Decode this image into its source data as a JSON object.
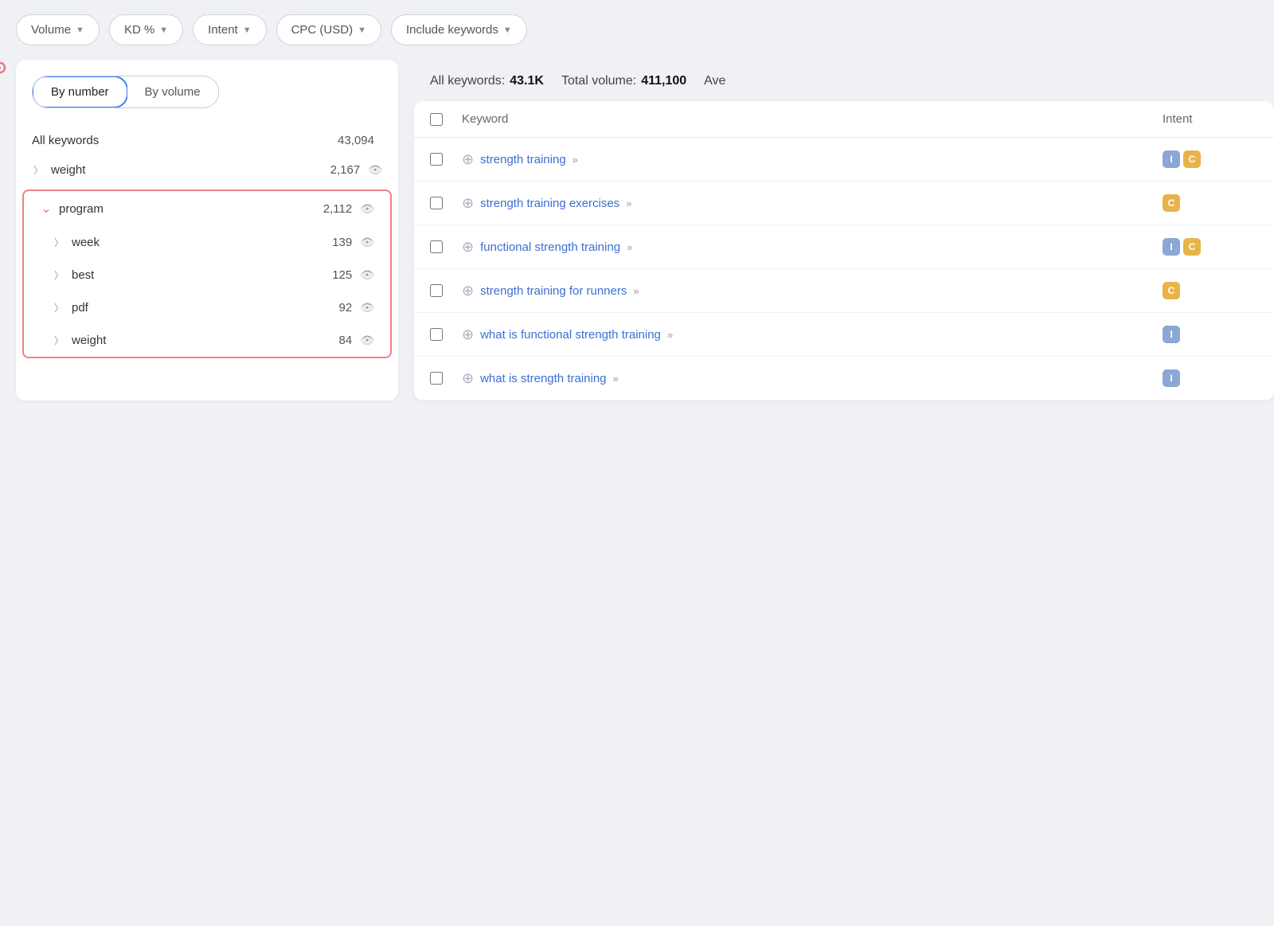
{
  "filterBar": {
    "buttons": [
      {
        "label": "Volume",
        "id": "volume"
      },
      {
        "label": "KD %",
        "id": "kd"
      },
      {
        "label": "Intent",
        "id": "intent"
      },
      {
        "label": "CPC (USD)",
        "id": "cpc"
      },
      {
        "label": "Include keywords",
        "id": "include"
      }
    ]
  },
  "sidebar": {
    "toggles": [
      {
        "label": "By number",
        "active": true
      },
      {
        "label": "By volume",
        "active": false
      }
    ],
    "allKeywords": {
      "label": "All keywords",
      "count": "43,094"
    },
    "rows": [
      {
        "id": "weight-top",
        "indent": false,
        "expandable": true,
        "expanded": false,
        "label": "weight",
        "count": "2,167",
        "highlighted": false
      },
      {
        "id": "program",
        "indent": false,
        "expandable": true,
        "expanded": true,
        "label": "program",
        "count": "2,112",
        "highlighted": true
      },
      {
        "id": "week",
        "indent": true,
        "expandable": true,
        "expanded": false,
        "label": "week",
        "count": "139",
        "highlighted": false
      },
      {
        "id": "best",
        "indent": true,
        "expandable": true,
        "expanded": false,
        "label": "best",
        "count": "125",
        "highlighted": false
      },
      {
        "id": "pdf",
        "indent": true,
        "expandable": true,
        "expanded": false,
        "label": "pdf",
        "count": "92",
        "highlighted": false
      },
      {
        "id": "weight-sub",
        "indent": true,
        "expandable": true,
        "expanded": false,
        "label": "weight",
        "count": "84",
        "highlighted": false
      }
    ]
  },
  "statsBar": {
    "allKeywordsLabel": "All keywords:",
    "allKeywordsValue": "43.1K",
    "totalVolumeLabel": "Total volume:",
    "totalVolumeValue": "411,100",
    "aveLabel": "Ave"
  },
  "table": {
    "columns": {
      "keyword": "Keyword",
      "intent": "Intent"
    },
    "rows": [
      {
        "id": "row1",
        "keyword": "strength training",
        "badges": [
          "I",
          "C"
        ],
        "badgeTypes": [
          "i",
          "c"
        ]
      },
      {
        "id": "row2",
        "keyword": "strength training exercises",
        "badges": [
          "C"
        ],
        "badgeTypes": [
          "c"
        ]
      },
      {
        "id": "row3",
        "keyword": "functional strength training",
        "badges": [
          "I",
          "C"
        ],
        "badgeTypes": [
          "i",
          "c"
        ]
      },
      {
        "id": "row4",
        "keyword": "strength training for runners",
        "badges": [
          "C"
        ],
        "badgeTypes": [
          "c"
        ]
      },
      {
        "id": "row5",
        "keyword": "what is functional strength training",
        "badges": [
          "I"
        ],
        "badgeTypes": [
          "i"
        ]
      },
      {
        "id": "row6",
        "keyword": "what is strength training",
        "badges": [
          "I"
        ],
        "badgeTypes": [
          "i"
        ]
      }
    ]
  }
}
